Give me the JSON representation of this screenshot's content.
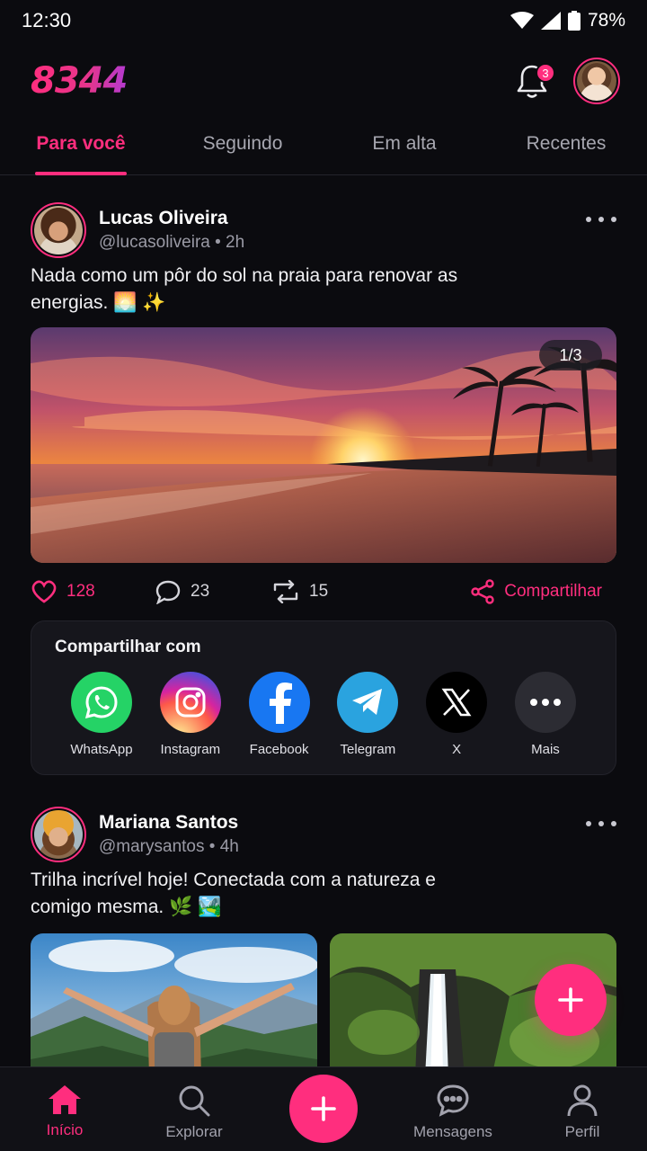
{
  "status_bar": {
    "time": "12:30",
    "battery": "78%"
  },
  "header": {
    "logo": "8344",
    "notifications_count": "3"
  },
  "tabs": [
    {
      "label": "Para você",
      "active": true
    },
    {
      "label": "Seguindo",
      "active": false
    },
    {
      "label": "Em alta",
      "active": false
    },
    {
      "label": "Recentes",
      "active": false
    }
  ],
  "posts": [
    {
      "name": "Lucas Oliveira",
      "handle": "@lucasoliveira",
      "time": "2h",
      "meta": "@lucasoliveira • 2h",
      "text": "Nada como um pôr do sol na praia para renovar as energias. 🌅 ✨",
      "media_counter": "1/3",
      "likes": "128",
      "comments": "23",
      "reposts": "15",
      "share_label": "Compartilhar",
      "share_panel": {
        "title": "Compartilhar com",
        "targets": [
          {
            "label": "WhatsApp",
            "icon": "whatsapp-icon",
            "color": "#25d366"
          },
          {
            "label": "Instagram",
            "icon": "instagram-icon",
            "color": "#e1306c"
          },
          {
            "label": "Facebook",
            "icon": "facebook-icon",
            "color": "#1877f2"
          },
          {
            "label": "Telegram",
            "icon": "telegram-icon",
            "color": "#2aa3df"
          },
          {
            "label": "X",
            "icon": "x-icon",
            "color": "#000000"
          },
          {
            "label": "Mais",
            "icon": "more-icon",
            "color": "#2c2c33"
          }
        ]
      }
    },
    {
      "name": "Mariana Santos",
      "handle": "@marysantos",
      "time": "4h",
      "meta": "@marysantos • 4h",
      "text": "Trilha incrível hoje! Conectada com a natureza e comigo mesma. 🌿 🏞️"
    }
  ],
  "bottom_nav": [
    {
      "label": "Início",
      "icon": "home-icon",
      "active": true
    },
    {
      "label": "Explorar",
      "icon": "search-icon",
      "active": false
    },
    {
      "label": "",
      "icon": "plus-icon",
      "active": false
    },
    {
      "label": "Mensagens",
      "icon": "messages-icon",
      "active": false
    },
    {
      "label": "Perfil",
      "icon": "profile-icon",
      "active": false
    }
  ],
  "colors": {
    "accent": "#ff2e7e",
    "background": "#0b0b0f"
  }
}
